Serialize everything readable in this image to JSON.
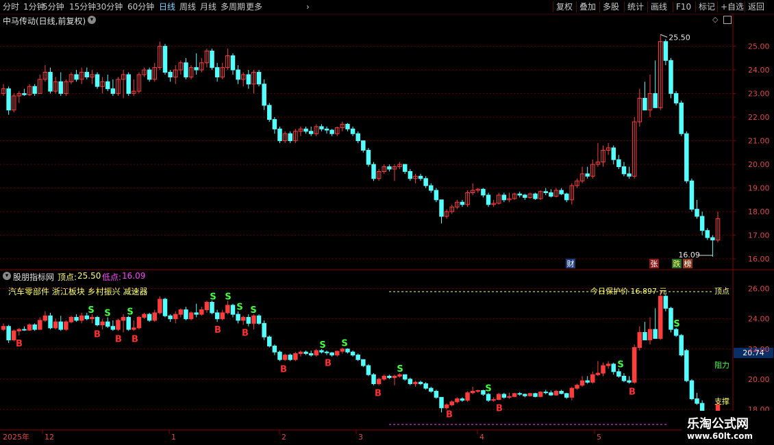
{
  "toolbar_left": [
    {
      "label": "分时",
      "cyan": false
    },
    {
      "label": "1分钟",
      "cyan": false
    },
    {
      "label": "5分钟",
      "cyan": false
    },
    {
      "label": "15分钟",
      "cyan": false
    },
    {
      "label": "30分钟",
      "cyan": false
    },
    {
      "label": "60分钟",
      "cyan": false
    },
    {
      "label": "日线",
      "cyan": true
    },
    {
      "label": "周线",
      "cyan": false
    },
    {
      "label": "月线",
      "cyan": false
    },
    {
      "label": "多周期",
      "cyan": false
    },
    {
      "label": "更多",
      "cyan": false
    }
  ],
  "toolbar_right": [
    "复权",
    "叠加",
    "多股",
    "统计",
    "画线",
    "F10",
    "标记",
    "+自选",
    "返回"
  ],
  "main": {
    "title": "中马传动(日线,前复权)",
    "high_label": "25.50",
    "low_label": "16.09",
    "y_ticks": [
      "25.00",
      "24.00",
      "23.00",
      "22.00",
      "21.00",
      "20.00",
      "19.00",
      "18.00",
      "17.00",
      "16.00"
    ],
    "markers": [
      {
        "text": "财",
        "color": "#ffffff",
        "bg": "#1f3c7a"
      },
      {
        "text": "张",
        "color": "#ffffff",
        "bg": "#8a1a1a"
      },
      {
        "text": "跌",
        "color": "#ffff66",
        "bg": "#2a6a2a"
      },
      {
        "text": "榜",
        "color": "#ffffff",
        "bg": "#8a3a1a"
      }
    ]
  },
  "indicator": {
    "name": "股朋指标网",
    "top_label": "顶点:",
    "top_value": "25.50",
    "low_label": "低点:",
    "low_value": "16.09",
    "sectors": "汽车零部件 浙江板块 乡村振兴 减速器",
    "protect_text": "今日保护价 16.897 元",
    "top_point": "顶点",
    "resist": "阻力",
    "support": "支撑",
    "current_price": "20.74",
    "y_ticks": [
      "26.00",
      "24.00",
      "22.00",
      "20.00",
      "18.00"
    ],
    "buy_label": "B",
    "sell_label": "S"
  },
  "dates": {
    "year": "2025年",
    "months": [
      "12",
      "1",
      "2",
      "3",
      "4",
      "5"
    ]
  },
  "watermark": {
    "line1": "乐淘公式网",
    "line2": "www.60lt.com"
  },
  "colors": {
    "up": "#ff3c3c",
    "down": "#54ffff",
    "grid": "#6a0000",
    "axis": "#8a0000",
    "buy": "#ff3030",
    "sell": "#40ff40",
    "yellow": "#ffff66",
    "magenta": "#ff44ff"
  },
  "chart_data": {
    "type": "candlestick",
    "title": "中马传动(日线,前复权)",
    "ylim": [
      15.8,
      25.8
    ],
    "indicator_ylim": [
      17.0,
      26.8
    ],
    "max": 25.5,
    "min": 16.09,
    "ohlc": [
      [
        23.0,
        23.4,
        22.9,
        23.2
      ],
      [
        23.2,
        23.3,
        22.1,
        22.3
      ],
      [
        22.3,
        23.0,
        22.2,
        22.9
      ],
      [
        22.9,
        23.1,
        22.6,
        23.0
      ],
      [
        23.0,
        23.2,
        22.9,
        22.95
      ],
      [
        22.95,
        23.4,
        22.9,
        23.3
      ],
      [
        23.3,
        23.4,
        22.9,
        23.0
      ],
      [
        23.0,
        23.8,
        23.0,
        23.6
      ],
      [
        23.6,
        24.2,
        23.5,
        23.9
      ],
      [
        23.9,
        24.1,
        23.0,
        23.1
      ],
      [
        23.1,
        23.7,
        23.0,
        23.5
      ],
      [
        23.5,
        23.9,
        22.9,
        23.0
      ],
      [
        23.0,
        23.6,
        22.9,
        23.5
      ],
      [
        23.5,
        23.9,
        23.4,
        23.8
      ],
      [
        23.8,
        24.0,
        23.5,
        23.6
      ],
      [
        23.6,
        24.1,
        23.4,
        23.9
      ],
      [
        23.9,
        24.1,
        23.6,
        23.7
      ],
      [
        23.7,
        24.0,
        23.4,
        23.8
      ],
      [
        23.8,
        23.9,
        23.2,
        23.3
      ],
      [
        23.3,
        23.7,
        23.0,
        23.5
      ],
      [
        23.5,
        23.8,
        23.1,
        23.2
      ],
      [
        23.2,
        23.6,
        22.9,
        23.0
      ],
      [
        23.0,
        23.7,
        22.9,
        23.6
      ],
      [
        23.6,
        24.0,
        22.8,
        23.8
      ],
      [
        23.8,
        23.9,
        22.9,
        23.0
      ],
      [
        23.0,
        23.6,
        22.9,
        23.1
      ],
      [
        23.1,
        23.9,
        23.0,
        23.8
      ],
      [
        23.8,
        24.1,
        23.7,
        24.0
      ],
      [
        24.0,
        24.1,
        23.5,
        23.6
      ],
      [
        23.6,
        24.3,
        23.5,
        24.1
      ],
      [
        24.1,
        25.2,
        24.0,
        25.0
      ],
      [
        25.0,
        25.1,
        23.8,
        23.9
      ],
      [
        23.9,
        24.0,
        23.5,
        23.7
      ],
      [
        23.7,
        24.2,
        23.4,
        24.0
      ],
      [
        24.0,
        24.4,
        23.8,
        24.3
      ],
      [
        24.3,
        24.5,
        23.6,
        23.7
      ],
      [
        23.7,
        24.2,
        23.6,
        24.1
      ],
      [
        24.1,
        24.7,
        23.8,
        24.0
      ],
      [
        24.0,
        24.5,
        23.9,
        24.3
      ],
      [
        24.3,
        24.9,
        24.1,
        24.8
      ],
      [
        24.8,
        24.9,
        24.0,
        24.1
      ],
      [
        24.1,
        24.3,
        23.5,
        23.7
      ],
      [
        23.7,
        24.3,
        23.6,
        24.1
      ],
      [
        24.1,
        24.9,
        24.0,
        24.6
      ],
      [
        24.6,
        24.7,
        23.8,
        24.0
      ],
      [
        24.0,
        24.2,
        23.4,
        23.6
      ],
      [
        23.6,
        23.9,
        23.3,
        23.8
      ],
      [
        23.8,
        24.0,
        23.2,
        23.4
      ],
      [
        23.4,
        24.0,
        23.0,
        23.9
      ],
      [
        23.9,
        24.0,
        23.3,
        23.4
      ],
      [
        23.4,
        23.6,
        22.3,
        22.5
      ],
      [
        22.5,
        22.6,
        21.8,
        21.9
      ],
      [
        21.9,
        22.0,
        21.3,
        21.5
      ],
      [
        21.5,
        21.6,
        20.9,
        21.0
      ],
      [
        21.0,
        21.4,
        20.9,
        21.3
      ],
      [
        21.3,
        21.4,
        20.9,
        21.0
      ],
      [
        21.0,
        21.5,
        20.9,
        21.4
      ],
      [
        21.4,
        21.6,
        21.2,
        21.5
      ],
      [
        21.5,
        21.6,
        21.3,
        21.4
      ],
      [
        21.4,
        21.6,
        21.2,
        21.3
      ],
      [
        21.3,
        21.7,
        21.2,
        21.6
      ],
      [
        21.6,
        21.7,
        21.4,
        21.5
      ],
      [
        21.5,
        21.6,
        21.3,
        21.45
      ],
      [
        21.45,
        21.5,
        21.2,
        21.3
      ],
      [
        21.3,
        21.6,
        21.2,
        21.55
      ],
      [
        21.55,
        21.8,
        21.4,
        21.7
      ],
      [
        21.7,
        21.75,
        21.4,
        21.5
      ],
      [
        21.5,
        21.6,
        21.2,
        21.3
      ],
      [
        21.3,
        21.4,
        20.9,
        21.0
      ],
      [
        21.0,
        21.0,
        20.5,
        20.6
      ],
      [
        20.6,
        20.7,
        19.9,
        20.0
      ],
      [
        20.0,
        20.1,
        19.3,
        19.4
      ],
      [
        19.4,
        19.8,
        19.3,
        19.7
      ],
      [
        19.7,
        20.0,
        19.6,
        19.9
      ],
      [
        19.9,
        20.0,
        19.7,
        19.8
      ],
      [
        19.8,
        20.0,
        19.3,
        19.9
      ],
      [
        19.9,
        20.1,
        19.8,
        20.0
      ],
      [
        20.0,
        20.0,
        19.6,
        19.7
      ],
      [
        19.7,
        19.8,
        19.3,
        19.4
      ],
      [
        19.4,
        19.6,
        19.2,
        19.5
      ],
      [
        19.5,
        19.6,
        19.3,
        19.4
      ],
      [
        19.4,
        19.5,
        19.0,
        19.1
      ],
      [
        19.1,
        19.2,
        18.8,
        18.9
      ],
      [
        18.9,
        19.0,
        18.4,
        18.5
      ],
      [
        18.5,
        18.5,
        17.5,
        17.8
      ],
      [
        17.8,
        18.1,
        17.7,
        18.0
      ],
      [
        18.0,
        18.3,
        17.9,
        18.2
      ],
      [
        18.2,
        18.5,
        18.1,
        18.4
      ],
      [
        18.4,
        18.5,
        18.2,
        18.3
      ],
      [
        18.3,
        18.9,
        18.2,
        18.8
      ],
      [
        18.8,
        19.2,
        18.7,
        18.9
      ],
      [
        18.9,
        19.0,
        18.8,
        18.95
      ],
      [
        18.95,
        19.0,
        18.6,
        18.7
      ],
      [
        18.7,
        18.8,
        18.2,
        18.3
      ],
      [
        18.3,
        18.5,
        18.2,
        18.35
      ],
      [
        18.35,
        18.8,
        18.3,
        18.7
      ],
      [
        18.7,
        18.8,
        18.4,
        18.5
      ],
      [
        18.5,
        18.8,
        18.4,
        18.55
      ],
      [
        18.55,
        18.8,
        18.5,
        18.75
      ],
      [
        18.75,
        18.85,
        18.6,
        18.7
      ],
      [
        18.7,
        18.75,
        18.5,
        18.6
      ],
      [
        18.6,
        18.8,
        18.55,
        18.75
      ],
      [
        18.75,
        18.8,
        18.5,
        18.55
      ],
      [
        18.55,
        18.9,
        18.5,
        18.85
      ],
      [
        18.85,
        19.0,
        18.7,
        18.8
      ],
      [
        18.8,
        18.95,
        18.6,
        18.65
      ],
      [
        18.65,
        19.0,
        18.6,
        18.9
      ],
      [
        18.9,
        19.0,
        18.7,
        18.75
      ],
      [
        18.75,
        18.8,
        18.4,
        18.5
      ],
      [
        18.5,
        19.2,
        18.3,
        19.1
      ],
      [
        19.1,
        19.4,
        19.0,
        19.3
      ],
      [
        19.3,
        19.9,
        19.2,
        19.6
      ],
      [
        19.6,
        19.9,
        19.4,
        19.5
      ],
      [
        19.5,
        20.2,
        19.4,
        20.0
      ],
      [
        20.0,
        20.9,
        19.9,
        20.1
      ],
      [
        20.1,
        20.8,
        19.9,
        20.6
      ],
      [
        20.6,
        20.9,
        20.4,
        20.7
      ],
      [
        20.7,
        20.8,
        20.0,
        20.2
      ],
      [
        20.2,
        20.4,
        19.8,
        19.9
      ],
      [
        19.9,
        20.1,
        19.5,
        19.6
      ],
      [
        19.6,
        19.9,
        19.4,
        19.5
      ],
      [
        19.5,
        22.0,
        19.4,
        21.8
      ],
      [
        21.8,
        23.2,
        21.6,
        22.8
      ],
      [
        22.8,
        23.5,
        22.5,
        22.3
      ],
      [
        22.3,
        23.8,
        22.0,
        23.0
      ],
      [
        23.0,
        24.4,
        22.5,
        22.4
      ],
      [
        22.4,
        25.5,
        22.3,
        25.2
      ],
      [
        25.2,
        25.3,
        24.2,
        24.4
      ],
      [
        24.4,
        24.5,
        22.8,
        23.0
      ],
      [
        23.0,
        23.1,
        22.5,
        22.6
      ],
      [
        22.6,
        22.7,
        21.2,
        21.3
      ],
      [
        21.3,
        21.4,
        19.2,
        19.3
      ],
      [
        19.3,
        19.4,
        18.0,
        18.1
      ],
      [
        18.1,
        18.5,
        17.7,
        17.8
      ],
      [
        17.8,
        18.0,
        17.0,
        17.2
      ],
      [
        17.2,
        17.3,
        16.8,
        16.9
      ],
      [
        16.9,
        17.0,
        16.09,
        16.8
      ],
      [
        16.8,
        18.0,
        16.7,
        17.7
      ]
    ],
    "buy_signals": [
      2,
      32,
      36,
      40,
      43,
      73,
      79,
      92,
      129,
      160,
      180,
      221
    ],
    "sell_signals": [
      32,
      43,
      74,
      74,
      76,
      99,
      112,
      113,
      141,
      172,
      233,
      253
    ]
  }
}
